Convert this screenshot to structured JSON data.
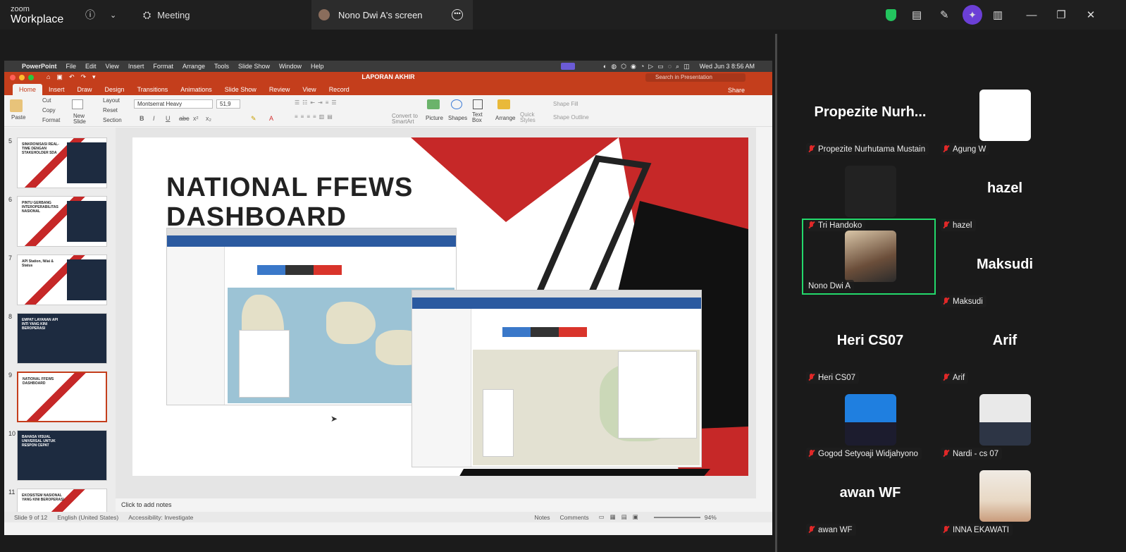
{
  "zoom": {
    "brand_small": "zoom",
    "brand_big": "Workplace",
    "meeting_label": "Meeting",
    "screen_tab": "Nono Dwi A's screen"
  },
  "mac": {
    "menu": [
      "PowerPoint",
      "File",
      "Edit",
      "View",
      "Insert",
      "Format",
      "Arrange",
      "Tools",
      "Slide Show",
      "Window",
      "Help"
    ],
    "clock": "Wed Jun 3  8:56 AM"
  },
  "ppt": {
    "doc_title": "LAPORAN AKHIR",
    "search_placeholder": "Search in Presentation",
    "tabs": [
      "Home",
      "Insert",
      "Draw",
      "Design",
      "Transitions",
      "Animations",
      "Slide Show",
      "Review",
      "View",
      "Record"
    ],
    "share": "Share",
    "ribbon": {
      "paste": "Paste",
      "cut": "Cut",
      "copy": "Copy",
      "format": "Format",
      "new_slide": "New Slide",
      "layout": "Layout",
      "reset": "Reset",
      "section": "Section",
      "font": "Montserrat Heavy",
      "size": "51,9",
      "convert": "Convert to SmartArt",
      "picture": "Picture",
      "shapes": "Shapes",
      "text_box": "Text Box",
      "arrange": "Arrange",
      "quick_styles": "Quick Styles",
      "shape_fill": "Shape Fill",
      "shape_outline": "Shape Outline"
    },
    "thumbnails": [
      {
        "num": "5",
        "title": "SINKRONISASI REAL-TIME DENGAN STAKEHOLDER SDA"
      },
      {
        "num": "6",
        "title": "PINTU GERBANG INTEROPERABILITAS NASIONAL"
      },
      {
        "num": "7",
        "title": "API Station, Nilai & Status"
      },
      {
        "num": "8",
        "title": "EMPAT LAYANAN API INTI YANG KINI BEROPERASI"
      },
      {
        "num": "9",
        "title": "NATIONAL FFEWS DASHBOARD"
      },
      {
        "num": "10",
        "title": "BAHASA VISUAL UNIVERSAL UNTUK RESPON CEPAT"
      },
      {
        "num": "11",
        "title": "EKOSISTEM NASIONAL YANG KINI BEROPERASI"
      }
    ],
    "slide_title_line1": "NATIONAL FFEWS",
    "slide_title_line2": "DASHBOARD",
    "notes_placeholder": "Click to add notes",
    "status": {
      "slide": "Slide 9 of 12",
      "language": "English (United States)",
      "accessibility": "Accessibility: Investigate",
      "notes": "Notes",
      "comments": "Comments",
      "zoom": "94%"
    }
  },
  "participants": [
    {
      "name": "Propezite Nurhutama Mustain",
      "big": "Propezite  Nurh...",
      "video": false
    },
    {
      "name": "Agung W",
      "big": "",
      "video": "white"
    },
    {
      "name": "Tri Handoko",
      "big": "",
      "video": "dark"
    },
    {
      "name": "hazel",
      "big": "hazel",
      "video": false
    },
    {
      "name": "Nono Dwi A",
      "big": "",
      "video": "photo",
      "active": true
    },
    {
      "name": "Maksudi",
      "big": "Maksudi",
      "video": false
    },
    {
      "name": "Heri CS07",
      "big": "Heri CS07",
      "video": false
    },
    {
      "name": "Arif",
      "big": "Arif",
      "video": false
    },
    {
      "name": "Gogod Setyoaji Widjahyono",
      "big": "",
      "video": "photo"
    },
    {
      "name": "Nardi - cs 07",
      "big": "",
      "video": "photo"
    },
    {
      "name": "awan WF",
      "big": "awan WF",
      "video": false
    },
    {
      "name": "INNA EKAWATI",
      "big": "",
      "video": "photo"
    }
  ]
}
